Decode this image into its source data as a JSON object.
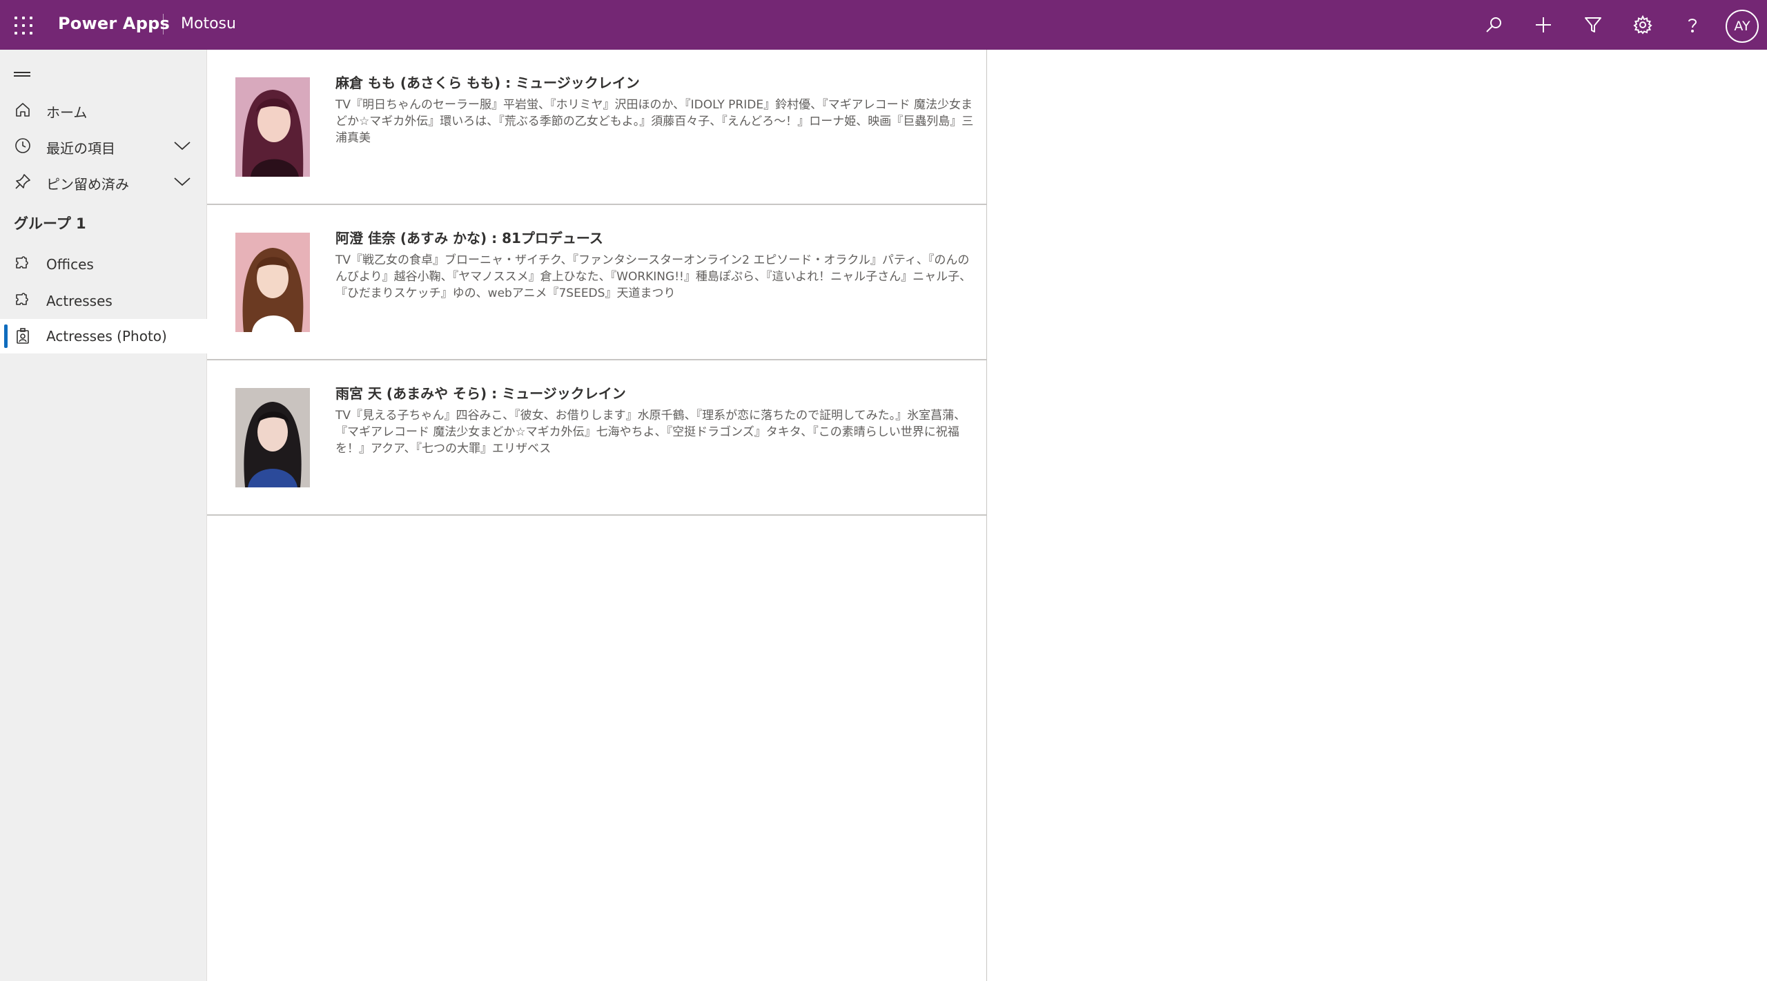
{
  "header": {
    "app_name": "Power Apps",
    "environment": "Motosu",
    "avatar_initials": "AY",
    "background_color": "#742774",
    "icons": [
      "search-icon",
      "add-icon",
      "filter-icon",
      "settings-icon",
      "help-icon"
    ]
  },
  "sidebar": {
    "items": [
      {
        "label": "ホーム",
        "icon": "home-icon"
      },
      {
        "label": "最近の項目",
        "icon": "clock-icon",
        "expandable": true
      },
      {
        "label": "ピン留め済み",
        "icon": "pin-icon",
        "expandable": true
      }
    ],
    "group_title": "グループ 1",
    "group_items": [
      {
        "label": "Offices",
        "icon": "puzzle-icon"
      },
      {
        "label": "Actresses",
        "icon": "puzzle-icon"
      },
      {
        "label": "Actresses (Photo)",
        "icon": "photo-id-icon",
        "selected": true
      }
    ],
    "selected_accent": "#0f6cbd"
  },
  "records": [
    {
      "title": "麻倉 もも (あさくら もも) : ミュージックレイン",
      "description": "TV『明日ちゃんのセーラー服』平岩蛍、『ホリミヤ』沢田ほのか、『IDOLY PRIDE』鈴村優、『マギアレコード 魔法少女まどか☆マギカ外伝』環いろは、『荒ぶる季節の乙女どもよ。』須藤百々子、『えんどろ〜！』ローナ姫、映画『巨蟲列島』三浦真美"
    },
    {
      "title": "阿澄 佳奈 (あすみ かな) : 81プロデュース",
      "description": "TV『戦乙女の食卓』ブローニャ・ザイチク、『ファンタシースターオンライン2 エピソード・オラクル』パティ、『のんのんびより』越谷小鞠、『ヤマノススメ』倉上ひなた、『WORKING!!』種島ぽぷら、『這いよれ！ニャル子さん』ニャル子、『ひだまりスケッチ』ゆの、webアニメ『7SEEDS』天道まつり"
    },
    {
      "title": "雨宮 天 (あまみや そら) : ミュージックレイン",
      "description": "TV『見える子ちゃん』四谷みこ、『彼女、お借りします』水原千鶴、『理系が恋に落ちたので証明してみた。』氷室菖蒲、『マギアレコード 魔法少女まどか☆マギカ外伝』七海やちよ、『空挺ドラゴンズ』タキタ、『この素晴らしい世界に祝福を！』アクア、『七つの大罪』エリザベス"
    }
  ]
}
